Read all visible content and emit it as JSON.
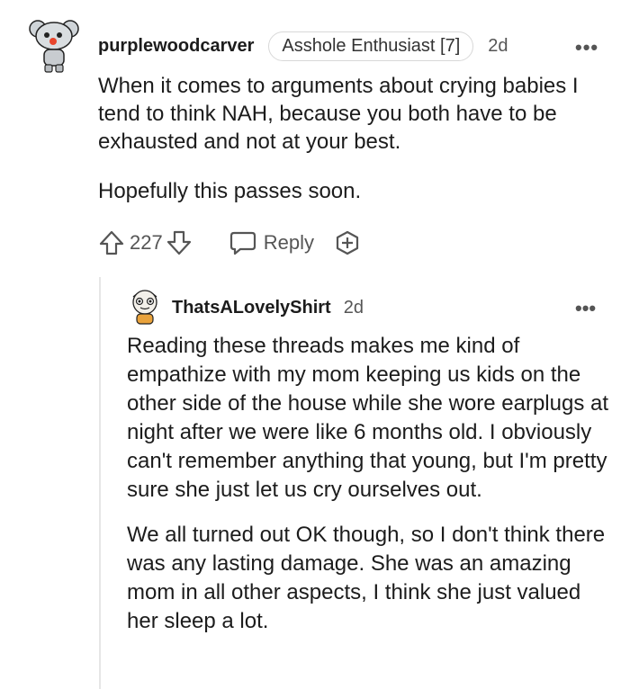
{
  "comment": {
    "username": "purplewoodcarver",
    "flair": "Asshole Enthusiast [7]",
    "age": "2d",
    "paragraphs": [
      "When it comes to arguments about crying babies I tend to think NAH, because you both have to be exhausted and not at your best.",
      "Hopefully this passes soon."
    ],
    "votes": "227",
    "reply_label": "Reply"
  },
  "reply": {
    "username": "ThatsALovelyShirt",
    "age": "2d",
    "paragraphs": [
      "Reading these threads makes me kind of empathize with my mom keeping us kids on the other side of the house while she wore earplugs at night after we were like 6 months old. I obviously can't remember anything that young, but I'm pretty sure she just let us cry ourselves out.",
      "We all turned out OK though, so I don't think there was any lasting damage. She was an amazing mom in all other aspects, I think she just valued her sleep a lot."
    ]
  },
  "icons": [
    "snoo-avatar-icon",
    "more-options-icon",
    "upvote-icon",
    "downvote-icon",
    "reply-bubble-icon",
    "award-icon",
    "snoo-avatar-icon"
  ],
  "colors": {
    "text": "#1c1c1c",
    "muted": "#555555",
    "thread_line": "#e6e6e6"
  }
}
